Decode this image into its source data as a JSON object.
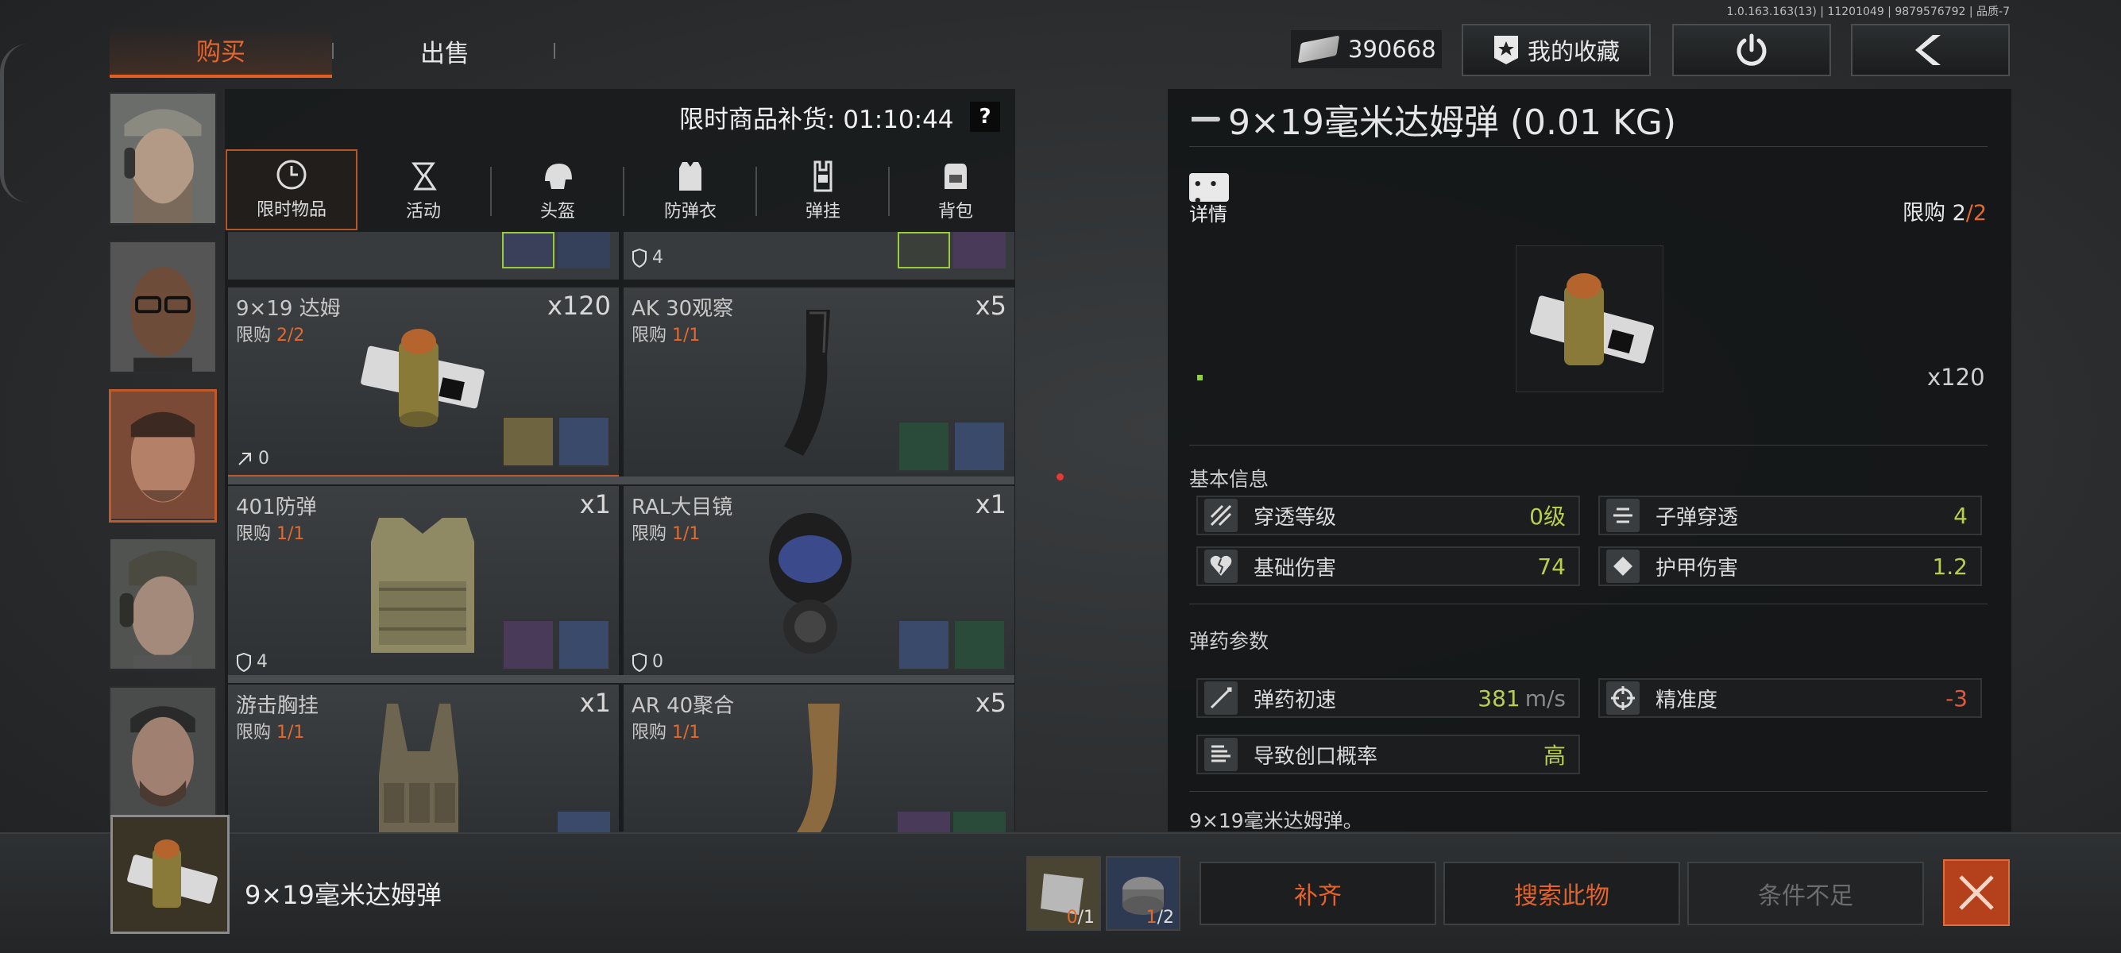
{
  "version": "1.0.163.163(13) | 11201049 | 9879576792 | 品质-7",
  "tabs": {
    "buy": "购买",
    "sell": "出售"
  },
  "money": "390668",
  "favorites_label": "我的收藏",
  "restock": "限时商品补货: 01:10:44",
  "help": "?",
  "categories": [
    "限时物品",
    "活动",
    "头盔",
    "防弹衣",
    "弹挂",
    "背包"
  ],
  "top_partial": {
    "dur": "4"
  },
  "items": [
    {
      "name": "9×19 达姆",
      "limit_label": "限购",
      "limit": "2/2",
      "qty": "x120",
      "dur": "0"
    },
    {
      "name": "AK 30观察",
      "limit_label": "限购",
      "limit": "1/1",
      "qty": "x5",
      "dur": ""
    },
    {
      "name": "401防弹",
      "limit_label": "限购",
      "limit": "1/1",
      "qty": "x1",
      "dur": "4"
    },
    {
      "name": "RAL大目镜",
      "limit_label": "限购",
      "limit": "1/1",
      "qty": "x1",
      "dur": "0"
    },
    {
      "name": "游击胸挂",
      "limit_label": "限购",
      "limit": "1/1",
      "qty": "x1",
      "dur": ""
    },
    {
      "name": "AR 40聚合",
      "limit_label": "限购",
      "limit": "1/1",
      "qty": "x5",
      "dur": ""
    }
  ],
  "detail": {
    "title": "9×19毫米达姆弹 (0.01 KG)",
    "detail_label": "详情",
    "limit_label": "限购",
    "limit_cur": "2",
    "limit_max": "/2",
    "preview_qty": "x120",
    "basic_info": "基本信息",
    "ammo_params": "弹药参数",
    "stats": [
      {
        "label": "穿透等级",
        "value": "0级"
      },
      {
        "label": "子弹穿透",
        "value": "4"
      },
      {
        "label": "基础伤害",
        "value": "74"
      },
      {
        "label": "护甲伤害",
        "value": "1.2"
      }
    ],
    "ammo": [
      {
        "label": "弹药初速",
        "value": "381",
        "unit": "m/s"
      },
      {
        "label": "精准度",
        "value": "-3"
      },
      {
        "label": "导致创口概率",
        "value": "高"
      }
    ],
    "description": "9×19毫米达姆弹。"
  },
  "bottom": {
    "selected_name": "9×19毫米达姆弹",
    "req1_have": "0",
    "req1_need": "/1",
    "req2_have": "1",
    "req2_need": "/2",
    "refill": "补齐",
    "search": "搜索此物",
    "insufficient": "条件不足"
  },
  "colors": {
    "accent": "#e35e22",
    "limit": "#e4692c",
    "good": "#b6cf4f",
    "bad": "#e4573c"
  }
}
